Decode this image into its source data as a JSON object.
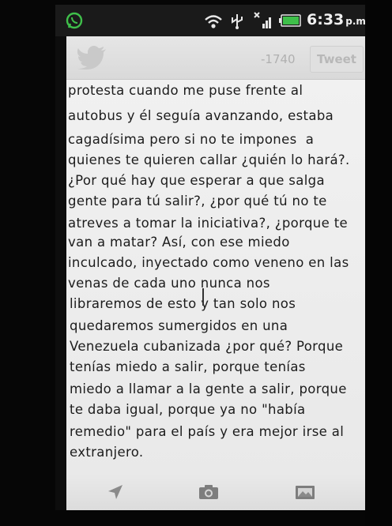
{
  "status_bar": {
    "time": "6:33",
    "ampm": "p.m.",
    "icons": [
      "whatsapp-icon",
      "wifi-icon",
      "usb-icon",
      "signal-icon",
      "battery-icon"
    ]
  },
  "compose": {
    "logo_icon": "twitter-bird-icon",
    "char_counter": "-1740",
    "tweet_button_label": "Tweet",
    "text_lines": [
      "protesta cuando me puse frente al",
      "autobus y él seguía avanzando, estaba",
      "cagadísima pero si no te impones  a",
      "quienes te quieren callar ¿quién lo hará?.",
      "¿Por qué hay que esperar a que salga",
      "gente para tú salir?, ¿por qué tú no te",
      "atreves a tomar la iniciativa?, ¿porque te",
      "van a matar? Así, con ese miedo",
      "inculcado, inyectado como veneno en las",
      "venas de cada uno nunca nos",
      "libraremos de esto y tan solo nos",
      "quedaremos sumergidos en una",
      "Venezuela cubanizada ¿por qué? Porque",
      "tenías miedo a salir, porque tenías",
      "miedo a llamar a la gente a salir, porque",
      "te daba igual, porque ya no \"había",
      "remedio\" para el país y era mejor irse al",
      "extranjero."
    ],
    "footer_icons": [
      "location-arrow-icon",
      "camera-icon",
      "gallery-icon"
    ]
  },
  "colors": {
    "status_bar_bg": "#1a1a1a",
    "compose_bg": "#efefef",
    "text": "#1c1c1c",
    "muted": "#b0b0b0"
  }
}
